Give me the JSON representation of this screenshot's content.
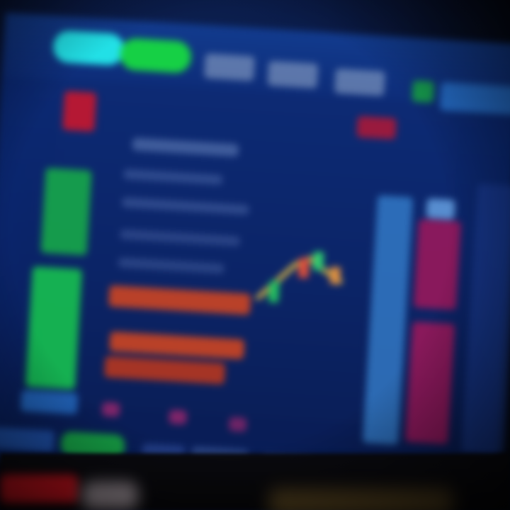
{
  "scene": {
    "kind": "blurred photograph of a trading terminal monitor",
    "colors": {
      "screen_background": "#0b2467",
      "accent_cyan": "#22e0e6",
      "accent_green": "#16d045",
      "accent_red": "#d81a3a",
      "accent_orange": "#d8461e",
      "accent_magenta": "#a0185a",
      "accent_light_blue": "#3a8ad8"
    },
    "icons": [
      "candlestick-chart-icon"
    ]
  }
}
